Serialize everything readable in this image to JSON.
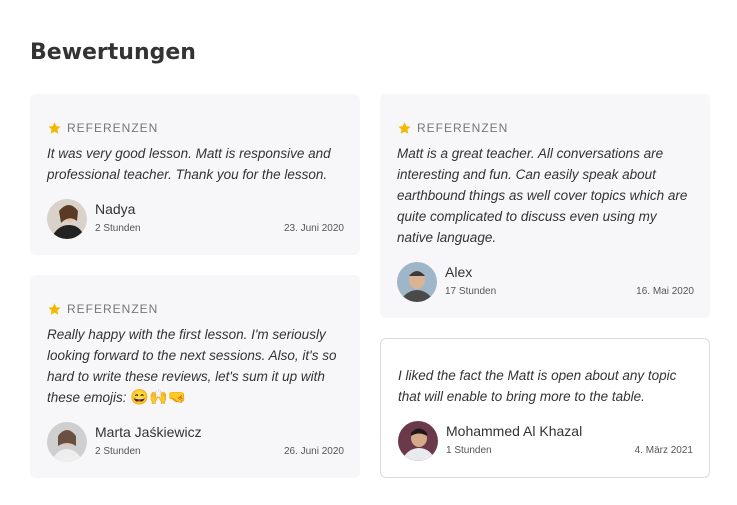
{
  "title": "Bewertungen",
  "tag_icon": "star-icon",
  "accent": "#f5b800",
  "reviews_left": [
    {
      "tag": "REFERENZEN",
      "text": "It was very good lesson. Matt is responsive and professional teacher. Thank you for the lesson.",
      "name": "Nadya",
      "ago": "2 Stunden",
      "date": "23. Juni 2020"
    },
    {
      "tag": "REFERENZEN",
      "text": "Really happy with the first lesson. I'm seriously looking forward to the next sessions. Also, it's so hard to write these reviews, let's sum it up with these emojis:",
      "emojis": "😄🙌🤜",
      "name": "Marta Jaśkiewicz",
      "ago": "2 Stunden",
      "date": "26. Juni 2020"
    }
  ],
  "reviews_right": [
    {
      "tag": "REFERENZEN",
      "text": "Matt is a great teacher. All conversations are interesting and fun. Can easily speak about earthbound things as well cover topics which are quite complicated to discuss even using my native language.",
      "name": "Alex",
      "ago": "17 Stunden",
      "date": "16. Mai 2020"
    },
    {
      "text": "I liked the fact the Matt is open about any topic that will enable to bring more to the table.",
      "name": "Mohammed Al Khazal",
      "ago": "1 Stunden",
      "date": "4. März 2021"
    }
  ]
}
